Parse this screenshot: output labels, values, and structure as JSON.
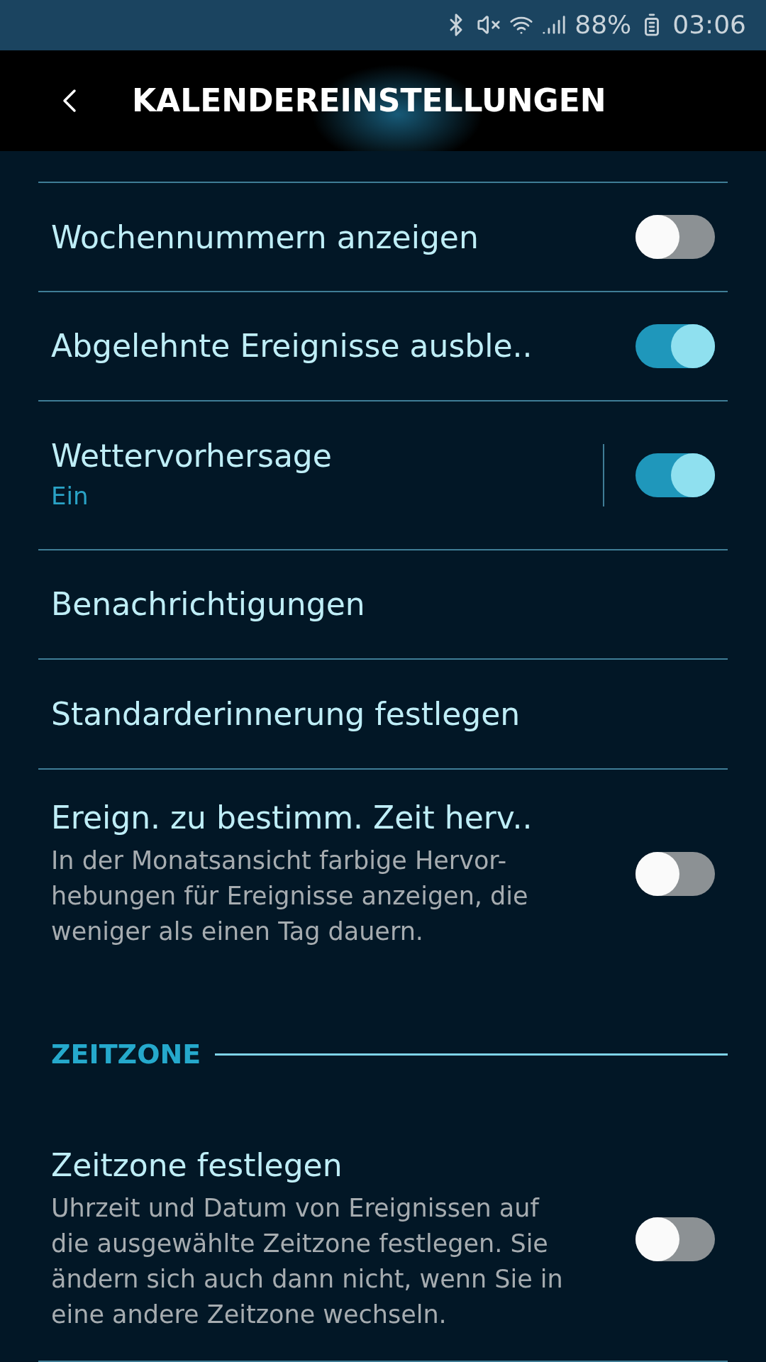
{
  "status_bar": {
    "battery": "88%",
    "time": "03:06"
  },
  "app_bar": {
    "title": "KALENDEREINSTELLUNGEN"
  },
  "items": [
    {
      "kind": "toggle",
      "title": "Wochennummern anzeigen",
      "on": false
    },
    {
      "kind": "toggle",
      "title": "Abgelehnte Ereignisse ausble..",
      "on": true
    },
    {
      "kind": "toggle",
      "title": "Wettervorhersage",
      "status": "Ein",
      "on": true,
      "split": true
    },
    {
      "kind": "link",
      "title": "Benachrichtigungen"
    },
    {
      "kind": "link",
      "title": "Standarderinnerung festlegen"
    },
    {
      "kind": "toggle",
      "title": "Ereign. zu bestimm. Zeit herv..",
      "description": [
        "In der Monatsansicht farbige Hervor-",
        "hebungen für Ereignisse anzeigen, die",
        "weniger als einen Tag dauern."
      ],
      "on": false
    },
    {
      "kind": "section",
      "title": "ZEITZONE"
    },
    {
      "kind": "toggle",
      "title": "Zeitzone festlegen",
      "description": [
        "Uhrzeit und Datum von Ereignissen auf",
        "die ausgewählte Zeitzone festlegen. Sie",
        "ändern sich auch dann nicht, wenn Sie in",
        "eine andere Zeitzone wechseln."
      ],
      "on": false
    }
  ]
}
